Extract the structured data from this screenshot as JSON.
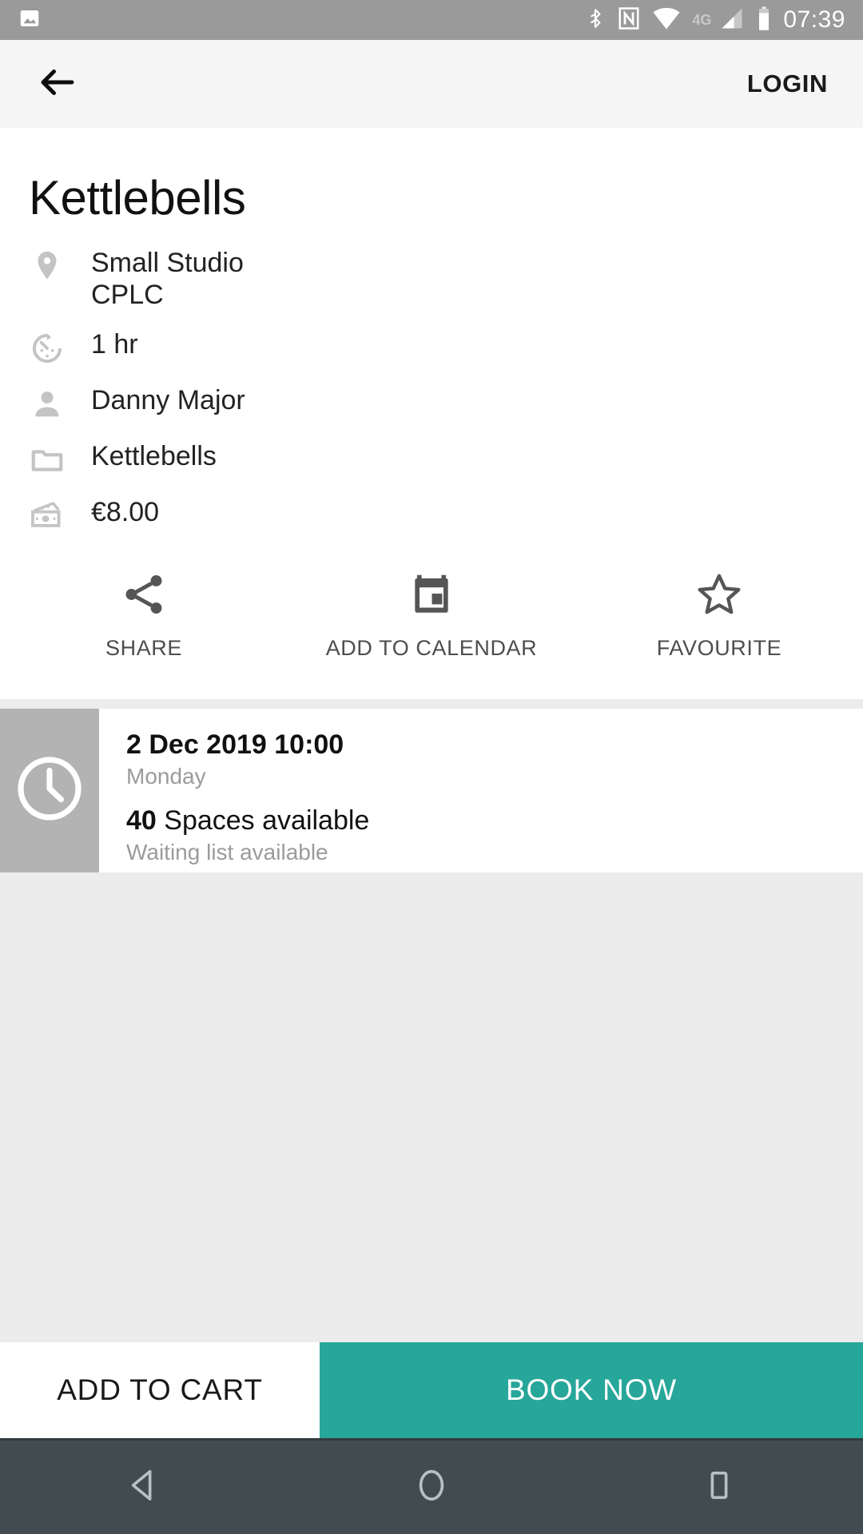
{
  "status_bar": {
    "gallery_icon": "image-icon",
    "bluetooth_icon": "bluetooth-icon",
    "nfc_icon": "nfc-icon",
    "wifi_icon": "wifi-icon",
    "network_type": "4G",
    "signal_icon": "signal-icon",
    "battery_icon": "battery-icon",
    "time": "07:39",
    "background_color": "#9a9a9a"
  },
  "toolbar": {
    "back_icon": "back-arrow-icon",
    "login_label": "LOGIN",
    "background_color": "#f5f5f5"
  },
  "class_detail": {
    "title": "Kettlebells",
    "rows": [
      {
        "icon": "location-pin-icon",
        "line1": "Small Studio",
        "line2": "CPLC"
      },
      {
        "icon": "timer-icon",
        "line1": "1 hr",
        "line2": ""
      },
      {
        "icon": "person-icon",
        "line1": "Danny Major",
        "line2": ""
      },
      {
        "icon": "folder-icon",
        "line1": "Kettlebells",
        "line2": ""
      },
      {
        "icon": "money-icon",
        "line1": "€8.00",
        "line2": ""
      }
    ]
  },
  "actions": [
    {
      "icon": "share-icon",
      "label": "SHARE"
    },
    {
      "icon": "calendar-icon",
      "label": "ADD TO CALENDAR"
    },
    {
      "icon": "star-outline-icon",
      "label": "FAVOURITE"
    }
  ],
  "sessions": [
    {
      "icon": "clock-icon",
      "date": "2 Dec 2019 10:00",
      "day": "Monday",
      "spaces_count": "40",
      "spaces_label": " Spaces available",
      "waiting": "Waiting list available"
    }
  ],
  "bottom_bar": {
    "add_to_cart_label": "ADD TO CART",
    "book_now_label": "BOOK NOW",
    "book_now_color": "#27a69a"
  },
  "nav_bar": {
    "back_icon": "nav-back-triangle-icon",
    "home_icon": "nav-home-circle-icon",
    "recents_icon": "nav-recents-square-icon",
    "background_color": "#414b50"
  }
}
